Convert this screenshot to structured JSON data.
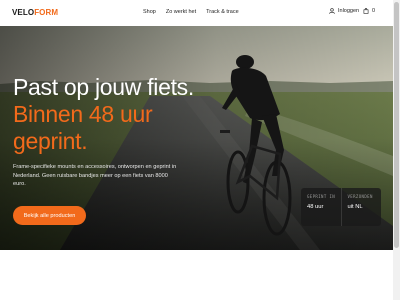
{
  "header": {
    "logo_part1": "VELO",
    "logo_part2": "FORM",
    "nav": [
      "Shop",
      "Zo werkt het",
      "Track & trace"
    ],
    "login_label": "Inloggen",
    "cart_count": "0"
  },
  "hero": {
    "line1": "Past op jouw fiets.",
    "line2": "Binnen 48 uur",
    "line3": "geprint.",
    "subtitle": "Frame-specifieke mounts en accessoires, ontworpen en geprint in Nederland. Geen ruisbare bandjes meer op een fiets van 8000 euro.",
    "cta_label": "Bekijk alle producten",
    "stats": [
      {
        "label": "GEPRINT IN",
        "value": "48 uur"
      },
      {
        "label": "VERZONDEN",
        "value": "uit NL"
      }
    ]
  },
  "colors": {
    "accent": "#f26a1b",
    "dark": "#1a1a1a"
  },
  "icons": [
    "user-icon",
    "cart-icon"
  ]
}
